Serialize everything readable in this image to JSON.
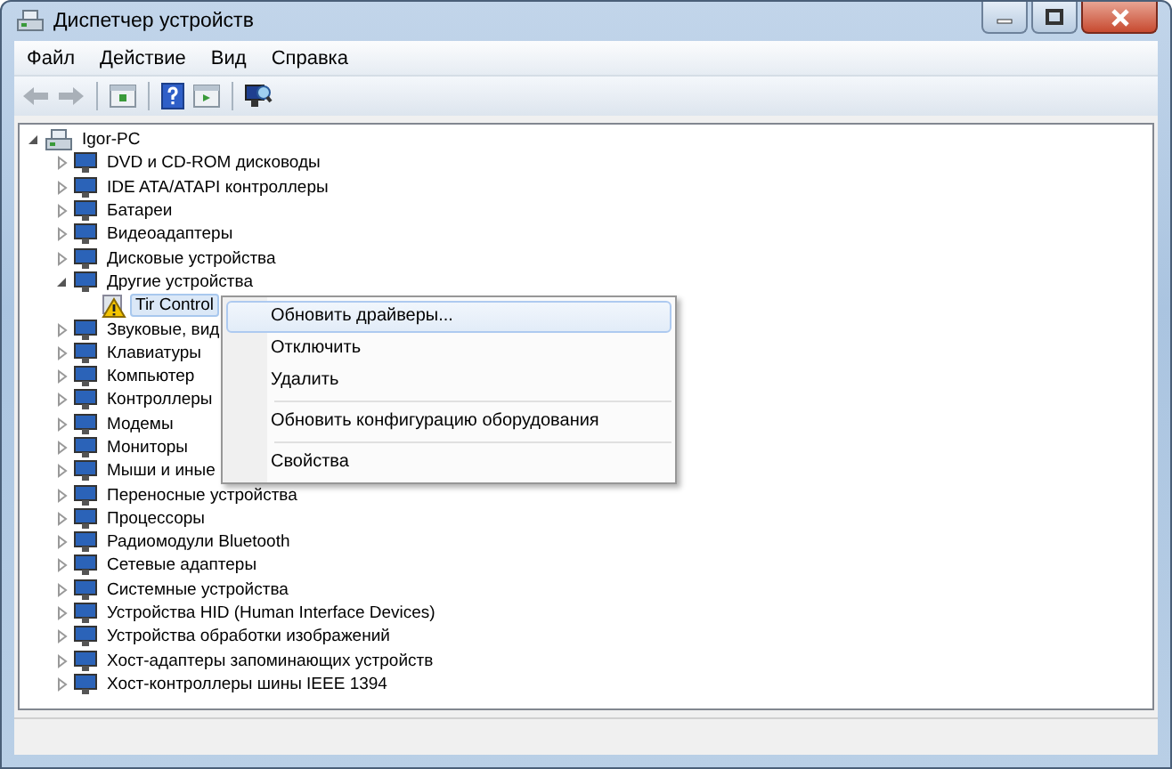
{
  "window": {
    "title": "Диспетчер устройств"
  },
  "menu_bar": [
    {
      "label": "Файл"
    },
    {
      "label": "Действие"
    },
    {
      "label": "Вид"
    },
    {
      "label": "Справка"
    }
  ],
  "tree": [
    {
      "label": "Igor-PC",
      "expanded": true,
      "selected": false,
      "children": [
        {
          "label": "DVD и CD-ROM дисководы",
          "expanded": false,
          "selected": false
        },
        {
          "label": "IDE ATA/ATAPI контроллеры",
          "expanded": false,
          "selected": false
        },
        {
          "label": "Батареи",
          "expanded": false,
          "selected": false
        },
        {
          "label": "Видеоадаптеры",
          "expanded": false,
          "selected": false
        },
        {
          "label": "Дисковые устройства",
          "expanded": false,
          "selected": false
        },
        {
          "label": "Другие устройства",
          "expanded": true,
          "selected": false,
          "children": [
            {
              "label": "Tir Control",
              "selected": true,
              "warning": true
            }
          ]
        },
        {
          "label": "Звуковые, вид",
          "expanded": false,
          "selected": false
        },
        {
          "label": "Клавиатуры",
          "expanded": false,
          "selected": false
        },
        {
          "label": "Компьютер",
          "expanded": false,
          "selected": false
        },
        {
          "label": "Контроллеры",
          "expanded": false,
          "selected": false
        },
        {
          "label": "Модемы",
          "expanded": false,
          "selected": false
        },
        {
          "label": "Мониторы",
          "expanded": false,
          "selected": false
        },
        {
          "label": "Мыши и иные",
          "expanded": false,
          "selected": false
        },
        {
          "label": "Переносные устройства",
          "expanded": false,
          "selected": false
        },
        {
          "label": "Процессоры",
          "expanded": false,
          "selected": false
        },
        {
          "label": "Радиомодули Bluetooth",
          "expanded": false,
          "selected": false
        },
        {
          "label": "Сетевые адаптеры",
          "expanded": false,
          "selected": false
        },
        {
          "label": "Системные устройства",
          "expanded": false,
          "selected": false
        },
        {
          "label": "Устройства HID (Human Interface Devices)",
          "expanded": false,
          "selected": false
        },
        {
          "label": "Устройства обработки изображений",
          "expanded": false,
          "selected": false
        },
        {
          "label": "Хост-адаптеры запоминающих устройств",
          "expanded": false,
          "selected": false
        },
        {
          "label": "Хост-контроллеры шины IEEE 1394",
          "expanded": false,
          "selected": false
        }
      ]
    }
  ],
  "context_menu": [
    {
      "kind": "item",
      "label": "Обновить драйверы...",
      "selected": true
    },
    {
      "kind": "item",
      "label": "Отключить",
      "selected": false
    },
    {
      "kind": "item",
      "label": "Удалить",
      "selected": false
    },
    {
      "kind": "separator"
    },
    {
      "kind": "item",
      "label": "Обновить конфигурацию оборудования",
      "selected": false
    },
    {
      "kind": "separator"
    },
    {
      "kind": "item",
      "label": "Свойства",
      "selected": false
    }
  ]
}
